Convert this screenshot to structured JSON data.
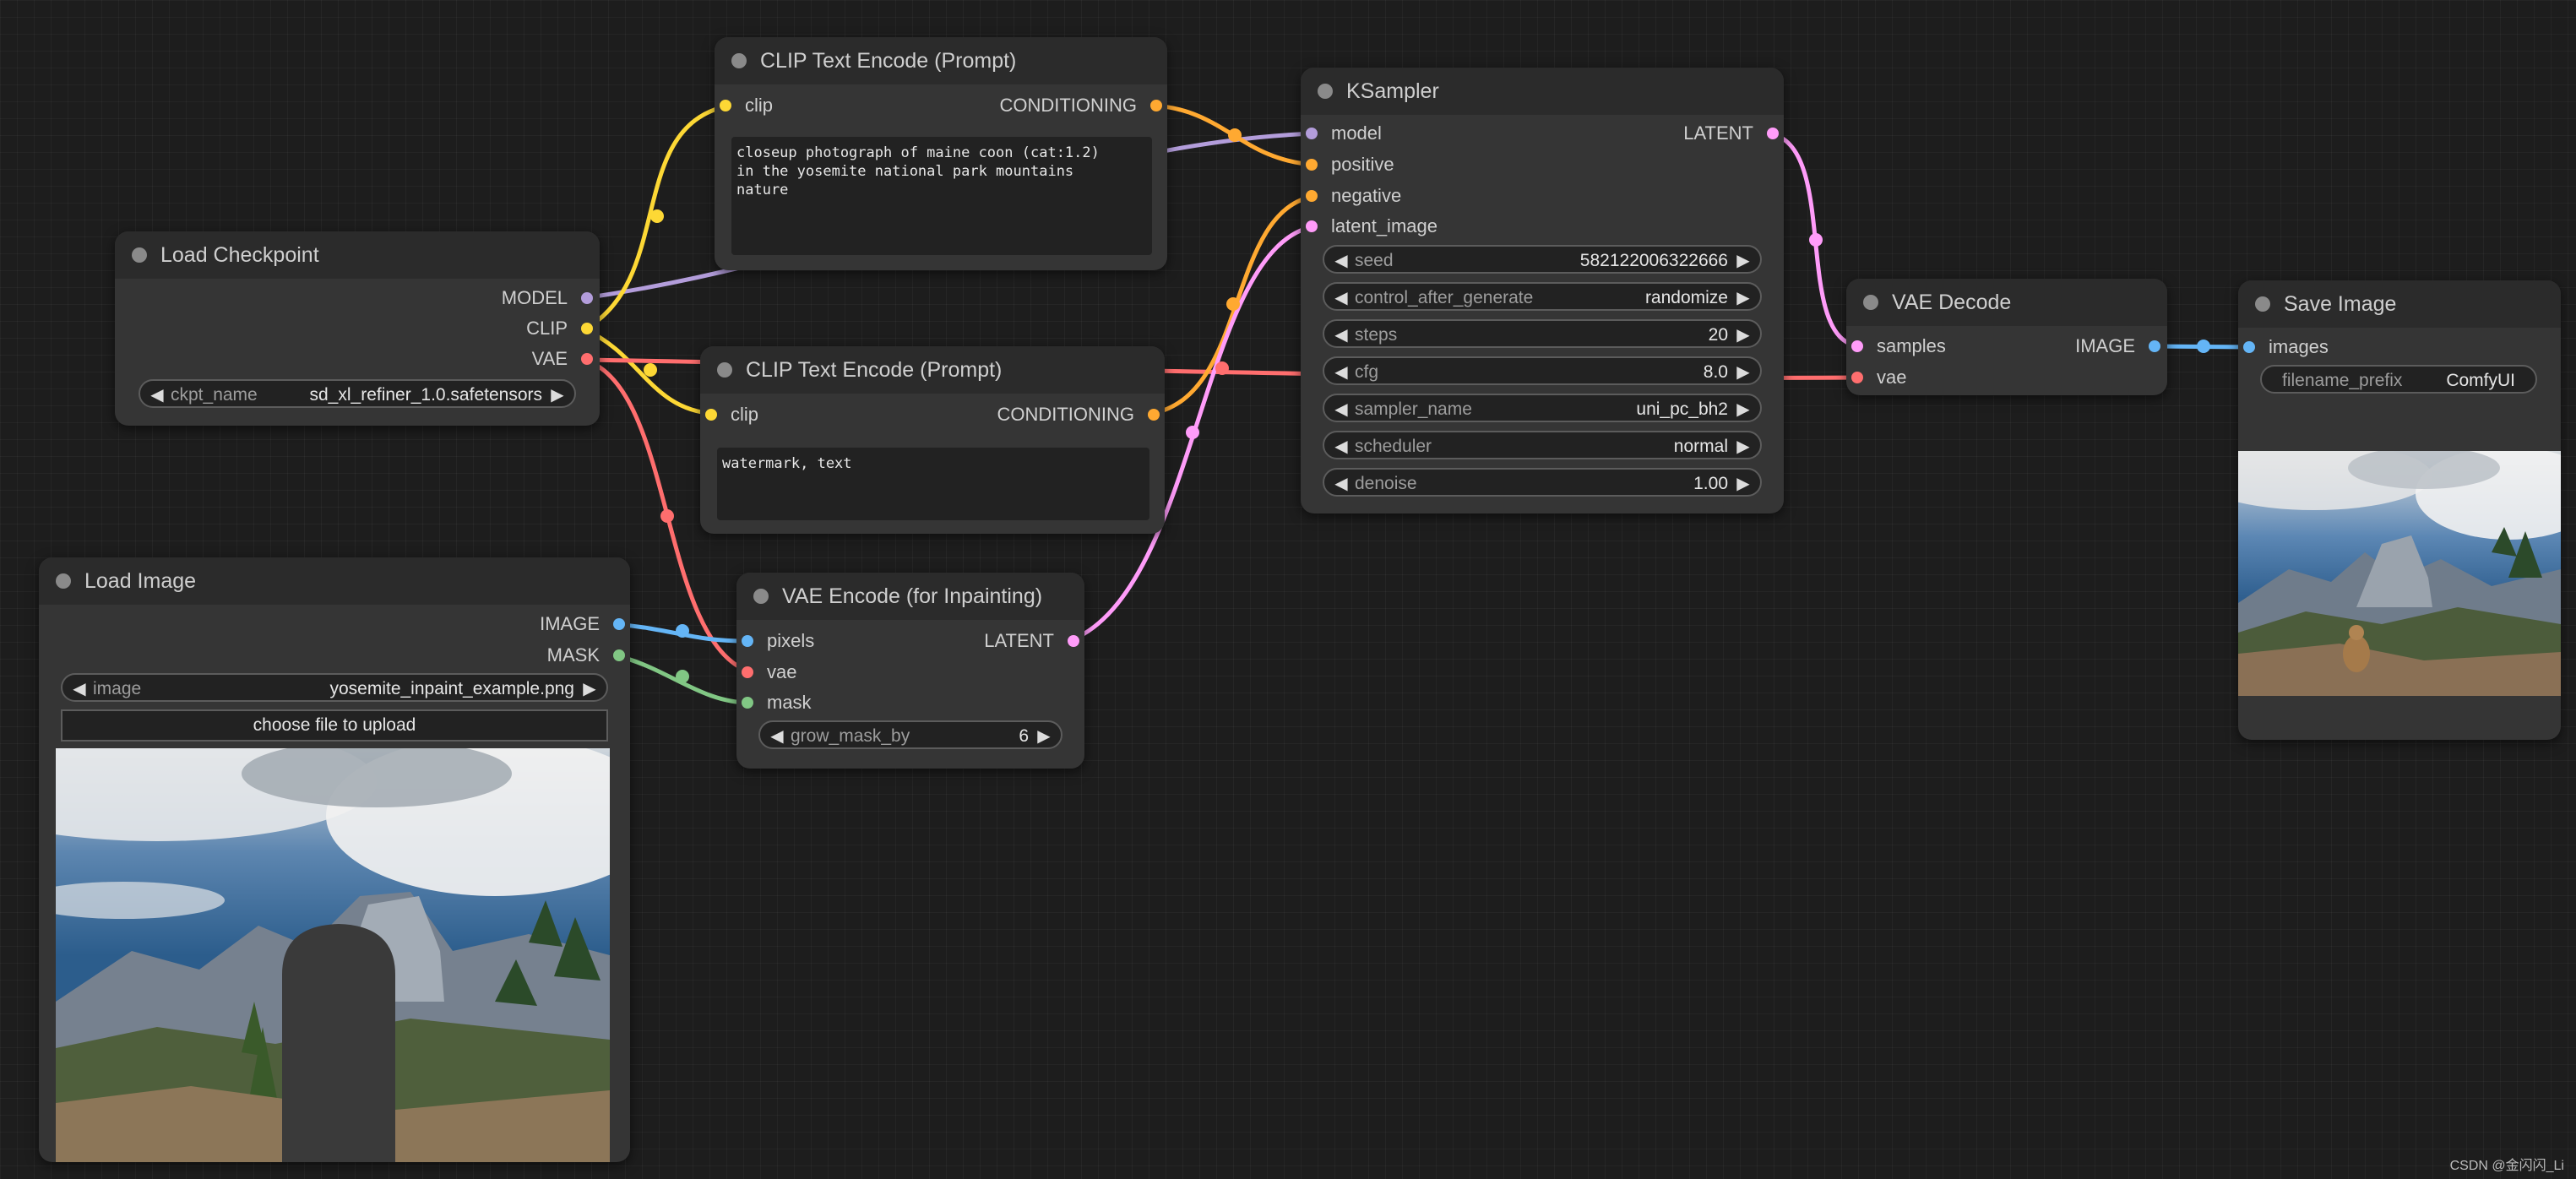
{
  "nodes": {
    "load_checkpoint": {
      "title": "Load Checkpoint",
      "outputs": [
        "MODEL",
        "CLIP",
        "VAE"
      ],
      "widget": {
        "label": "ckpt_name",
        "value": "sd_xl_refiner_1.0.safetensors"
      }
    },
    "clip_text_pos": {
      "title": "CLIP Text Encode (Prompt)",
      "input": "clip",
      "output": "CONDITIONING",
      "text": "closeup photograph of maine coon (cat:1.2)\nin the yosemite national park mountains\nnature"
    },
    "clip_text_neg": {
      "title": "CLIP Text Encode (Prompt)",
      "input": "clip",
      "output": "CONDITIONING",
      "text": "watermark, text"
    },
    "ksampler": {
      "title": "KSampler",
      "inputs": [
        "model",
        "positive",
        "negative",
        "latent_image"
      ],
      "output": "LATENT",
      "widgets": [
        {
          "label": "seed",
          "value": "582122006322666"
        },
        {
          "label": "control_after_generate",
          "value": "randomize"
        },
        {
          "label": "steps",
          "value": "20"
        },
        {
          "label": "cfg",
          "value": "8.0"
        },
        {
          "label": "sampler_name",
          "value": "uni_pc_bh2"
        },
        {
          "label": "scheduler",
          "value": "normal"
        },
        {
          "label": "denoise",
          "value": "1.00"
        }
      ]
    },
    "vae_decode": {
      "title": "VAE Decode",
      "inputs": [
        "samples",
        "vae"
      ],
      "output": "IMAGE"
    },
    "save_image": {
      "title": "Save Image",
      "input": "images",
      "widget": {
        "label": "filename_prefix",
        "value": "ComfyUI"
      }
    },
    "load_image": {
      "title": "Load Image",
      "outputs": [
        "IMAGE",
        "MASK"
      ],
      "widget": {
        "label": "image",
        "value": "yosemite_inpaint_example.png"
      },
      "upload_label": "choose file to upload"
    },
    "vae_encode": {
      "title": "VAE Encode (for Inpainting)",
      "inputs": [
        "pixels",
        "vae",
        "mask"
      ],
      "output": "LATENT",
      "widget": {
        "label": "grow_mask_by",
        "value": "6"
      }
    }
  },
  "colors": {
    "model": "#b39ddb",
    "clip": "#fdd835",
    "vae": "#ff6e6e",
    "conditioning": "#ffa931",
    "latent": "#ff9cf9",
    "image": "#64b5f6",
    "mask": "#81c784"
  },
  "icons": {
    "arrow_left": "◀",
    "arrow_right": "▶"
  },
  "watermark": "CSDN @金闪闪_Li"
}
